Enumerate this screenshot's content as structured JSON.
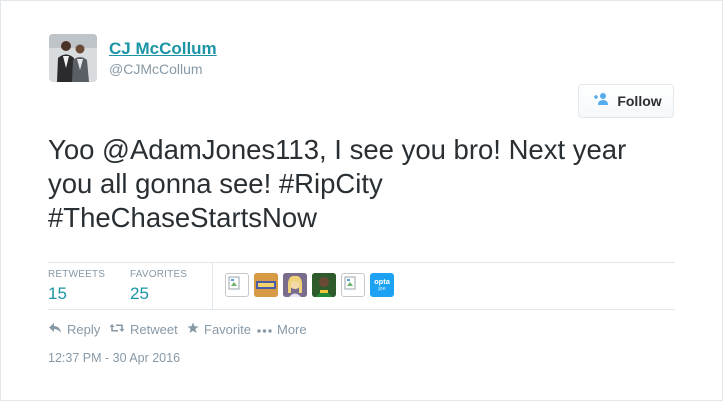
{
  "user": {
    "display_name": "CJ McCollum",
    "handle": "@CJMcCollum"
  },
  "follow_button": {
    "label": "Follow"
  },
  "tweet": {
    "lines": [
      "Yoo @AdamJones113, I see you bro! Next year",
      "you all gonna see! #RipCity",
      "#TheChaseStartsNow"
    ]
  },
  "stats": {
    "retweets_label": "RETWEETS",
    "retweets_value": "15",
    "favorites_label": "FAVORITES",
    "favorites_value": "25"
  },
  "favoriters": [
    {
      "icon": "broken-image-icon"
    },
    {
      "icon": "avatar-orange"
    },
    {
      "icon": "avatar-blonde"
    },
    {
      "icon": "avatar-green"
    },
    {
      "icon": "broken-image-icon"
    },
    {
      "icon": "opta-logo",
      "text_top": "opta",
      "text_bottom": "joe"
    }
  ],
  "actions": {
    "reply": "Reply",
    "retweet": "Retweet",
    "favorite": "Favorite",
    "more": "More"
  },
  "timestamp": "12:37 PM - 30 Apr 2016",
  "colors": {
    "link": "#1b95a6",
    "text": "#292f33",
    "muted": "#8899a6",
    "border": "#e1e8ed",
    "opta_blue": "#1da1f2"
  }
}
